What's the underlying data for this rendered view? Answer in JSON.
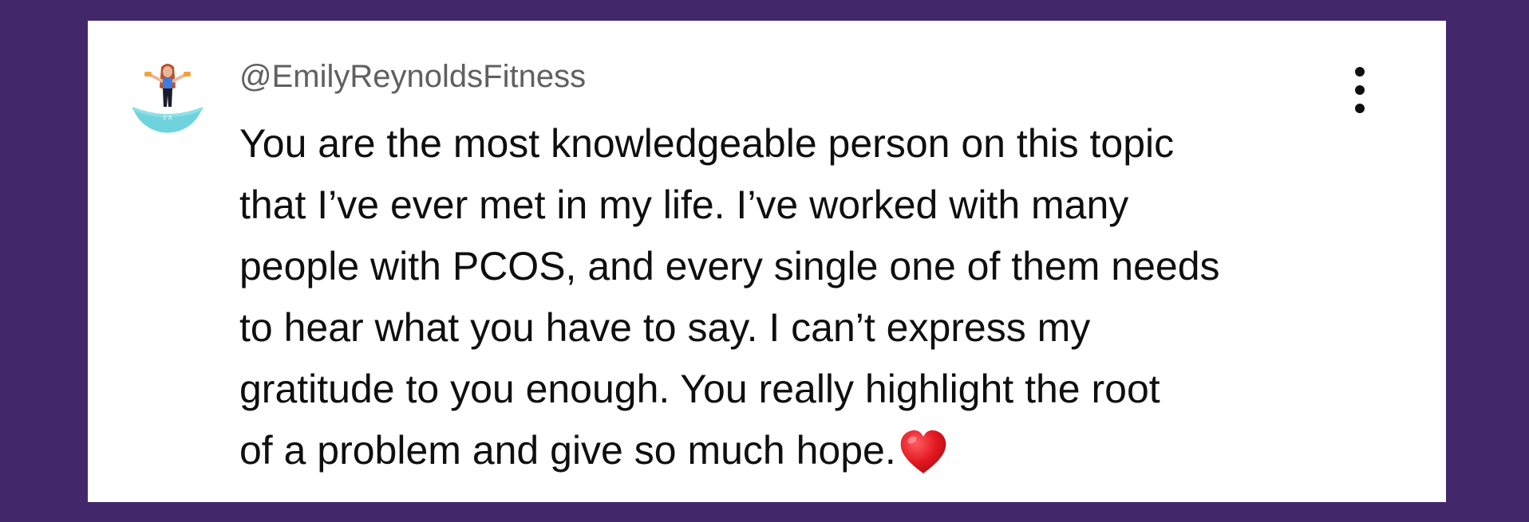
{
  "comment": {
    "author_handle": "@EmilyReynoldsFitness",
    "avatar_icon": "profile-avatar-woman-fitness",
    "more_menu_icon": "vertical-ellipsis-icon",
    "lines": [
      "You are the most knowledgeable person on this topic",
      "that I’ve ever met in my life. I’ve worked with many",
      "people with PCOS, and every single one of them needs",
      "to hear what you have to say. I can’t express my",
      "gratitude to you enough. You really highlight the root",
      "of a problem and give so much hope."
    ],
    "trailing_emoji": "red-heart-icon"
  },
  "colors": {
    "page_background": "#43276b",
    "card_background": "#ffffff",
    "handle_text": "#606060",
    "body_text": "#0f0f0f",
    "heart": "#e1171f",
    "avatar_accent": "#6fd3dd"
  }
}
